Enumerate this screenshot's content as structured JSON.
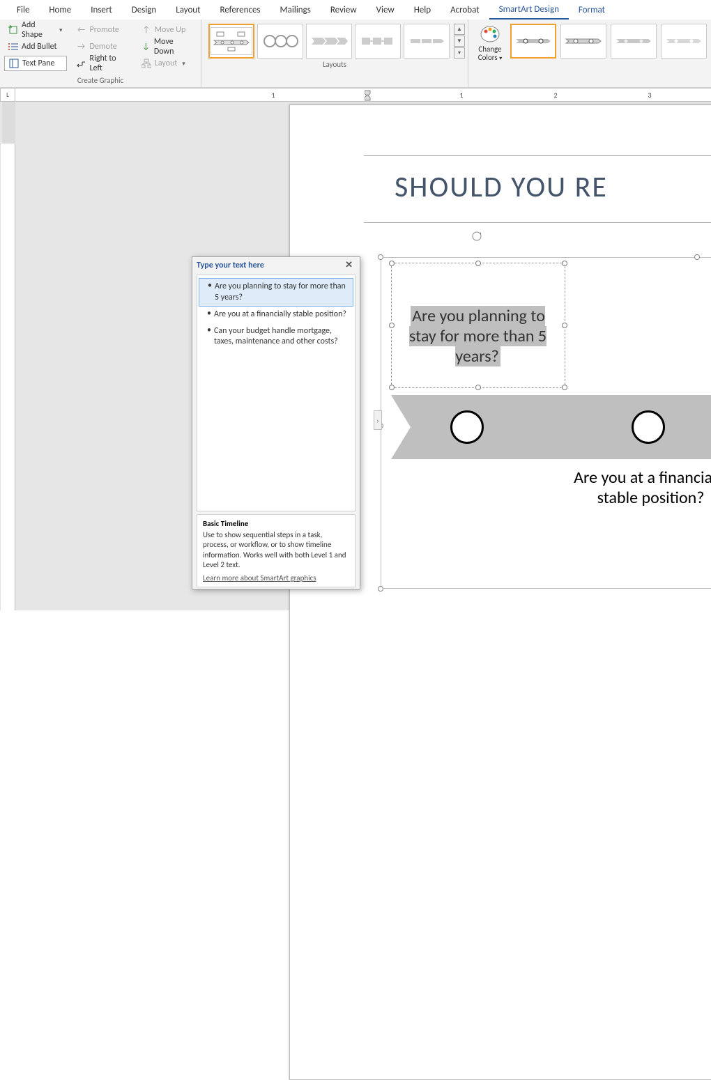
{
  "menu": {
    "tabs": [
      "File",
      "Home",
      "Insert",
      "Design",
      "Layout",
      "References",
      "Mailings",
      "Review",
      "View",
      "Help",
      "Acrobat",
      "SmartArt Design",
      "Format"
    ],
    "active": "SmartArt Design"
  },
  "ribbon": {
    "createGraphic": {
      "label": "Create Graphic",
      "addShape": "Add Shape",
      "addBullet": "Add Bullet",
      "textPane": "Text Pane",
      "promote": "Promote",
      "demote": "Demote",
      "rightToLeft": "Right to Left",
      "moveUp": "Move Up",
      "moveDown": "Move Down",
      "layout": "Layout"
    },
    "layouts": {
      "label": "Layouts"
    },
    "styles": {
      "changeColors": "Change Colors"
    }
  },
  "ruler": {
    "corner": "L",
    "labels": [
      "1",
      "",
      "1",
      "2",
      "3"
    ]
  },
  "document": {
    "title": "SHOULD YOU RE",
    "q1": "Are you planning to stay for more than 5 years?",
    "q2": "Are you at a financially stable position?"
  },
  "textPane": {
    "header": "Type your text here",
    "items": [
      "Are you planning to stay for more than 5 years?",
      "Are you at a financially stable position?",
      "Can your budget handle mortgage, taxes, maintenance and other costs?"
    ],
    "footerTitle": "Basic Timeline",
    "footerDesc": "Use to show sequential steps in a task, process, or workflow, or to show timeline information. Works well with both Level 1 and Level 2 text.",
    "footerLink": "Learn more about SmartArt graphics"
  }
}
